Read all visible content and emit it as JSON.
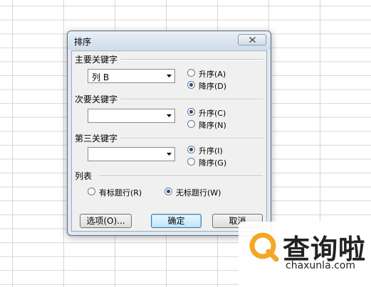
{
  "dialog": {
    "title": "排序",
    "close_icon": "close-icon"
  },
  "primary_key": {
    "label": "主要关键字",
    "value": "列 B",
    "ascending_label": "升序(A)",
    "descending_label": "降序(D)",
    "selected": "descending"
  },
  "secondary_key": {
    "label": "次要关键字",
    "value": "",
    "ascending_label": "升序(C)",
    "descending_label": "降序(N)",
    "selected": "ascending"
  },
  "tertiary_key": {
    "label": "第三关键字",
    "value": "",
    "ascending_label": "升序(I)",
    "descending_label": "降序(G)",
    "selected": "ascending"
  },
  "list": {
    "label": "列表",
    "has_header_label": "有标题行(R)",
    "no_header_label": "无标题行(W)",
    "selected": "no_header"
  },
  "buttons": {
    "options": "选项(O)...",
    "ok": "确定",
    "cancel": "取消"
  },
  "watermark": {
    "name": "查询啦",
    "url": "chaxunla.com",
    "logo_color": "#f5a623"
  }
}
